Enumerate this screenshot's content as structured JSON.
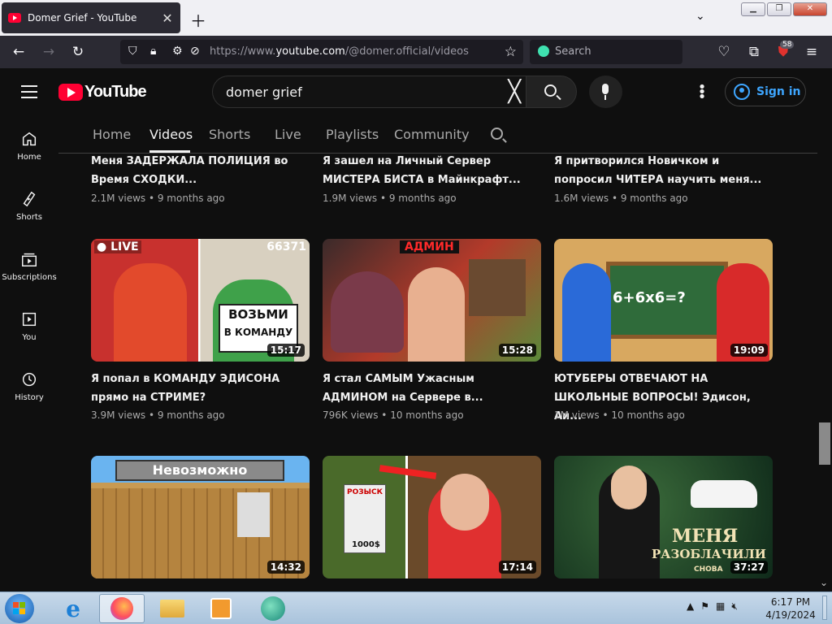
{
  "browser": {
    "tab_title": "Domer Grief - YouTube",
    "url_prefix": "https://www.",
    "url_host": "youtube.com",
    "url_path": "/@domer.official/videos",
    "search_placeholder": "Search",
    "extensions_badge": "58"
  },
  "youtube": {
    "logo_text": "YouTube",
    "search_query": "domer grief",
    "sign_in": "Sign in",
    "sidebar": [
      {
        "label": "Home",
        "icon": "home-icon"
      },
      {
        "label": "Shorts",
        "icon": "shorts-icon"
      },
      {
        "label": "Subscriptions",
        "icon": "subscriptions-icon"
      },
      {
        "label": "You",
        "icon": "you-icon"
      },
      {
        "label": "History",
        "icon": "history-icon"
      }
    ],
    "tabs": [
      "Home",
      "Videos",
      "Shorts",
      "Live",
      "Playlists",
      "Community"
    ],
    "active_tab": "Videos",
    "videos": [
      {
        "title": "Меня ЗАДЕРЖАЛА ПОЛИЦИЯ во Время СХОДКИ...",
        "views": "2.1M views",
        "age": "9 months ago"
      },
      {
        "title": "Я зашел на Личный Сервер МИСТЕРА БИСТА в Майнкрафт...",
        "views": "1.9M views",
        "age": "9 months ago"
      },
      {
        "title": "Я притворился Новичком и попросил ЧИТЕРА научить меня...",
        "views": "1.6M views",
        "age": "9 months ago"
      },
      {
        "title": "Я попал в КОМАНДУ ЭДИСОНА прямо на СТРИМЕ?",
        "views": "3.9M views",
        "age": "9 months ago",
        "duration": "15:17",
        "thumb_text": [
          "LIVE",
          "66371",
          "ВОЗЬМИ",
          "В КОМАНДУ"
        ]
      },
      {
        "title": "Я стал САМЫМ Ужасным АДМИНОМ на Сервере в...",
        "views": "796K views",
        "age": "10 months ago",
        "duration": "15:28",
        "thumb_text": [
          "АДМИН"
        ]
      },
      {
        "title": "ЮТУБЕРЫ ОТВЕЧАЮТ НА ШКОЛЬНЫЕ ВОПРОСЫ! Эдисон, Аи...",
        "views": "1M views",
        "age": "10 months ago",
        "duration": "19:09",
        "thumb_text": [
          "6+6x6=?"
        ]
      },
      {
        "duration": "14:32",
        "thumb_text": [
          "Невозможно"
        ]
      },
      {
        "duration": "17:14",
        "thumb_text": [
          "РОЗЫСК",
          "1000$"
        ]
      },
      {
        "duration": "37:27",
        "thumb_text": [
          "МЕНЯ",
          "РАЗОБЛАЧИЛИ",
          "СНОВА"
        ]
      }
    ]
  },
  "taskbar": {
    "time": "6:17 PM",
    "date": "4/19/2024"
  },
  "colors": {
    "yt_bg": "#0f0f0f",
    "yt_red": "#ff0033",
    "link_blue": "#3ea6ff",
    "browser_dark": "#2b2a33"
  }
}
